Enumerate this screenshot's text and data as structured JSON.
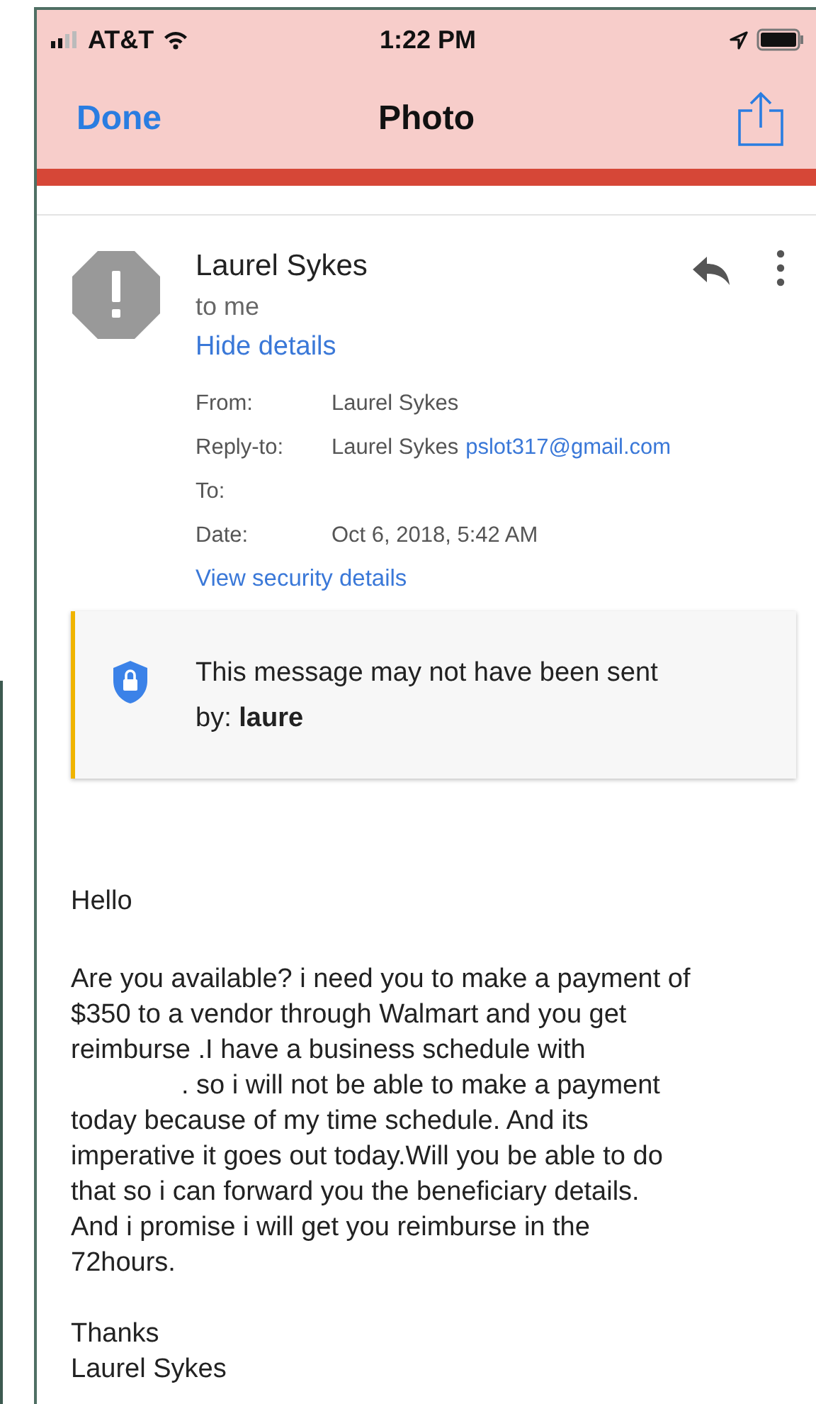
{
  "status_bar": {
    "carrier": "AT&T",
    "time": "1:22 PM"
  },
  "nav_bar": {
    "back": "Done",
    "title": "Photo"
  },
  "message": {
    "sender": "Laurel Sykes",
    "recipient_line": "to me",
    "details_toggle": "Hide details",
    "details": [
      {
        "label": "From:",
        "value": "Laurel Sykes"
      },
      {
        "label": "Reply-to:",
        "value": "Laurel Sykes",
        "email": "pslot317@gmail.com"
      },
      {
        "label": "To:"
      },
      {
        "label": "Date:",
        "value": "Oct 6, 2018, 5:42 AM"
      }
    ],
    "security_link": "View security details",
    "warning": {
      "line_1": "This message may not have been sent",
      "line_2": "by: **laure**"
    },
    "body": {
      "greeting": "Hello",
      "lines": [
        "Are you available? i need you to make a payment of",
        "$350 to a vendor through  Walmart and you get",
        "reimburse .I have a business schedule with",
        ". so i will not be able to make a payment",
        "today because of my time schedule. And its",
        "imperative it goes out today.Will you be able to do",
        "that so i can forward you the beneficiary details.",
        "And i promise i will get you reimburse in the",
        "72hours."
      ],
      "signoff": [
        "Thanks",
        "Laurel Sykes"
      ]
    }
  }
}
